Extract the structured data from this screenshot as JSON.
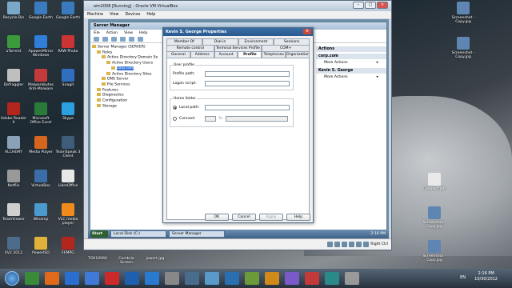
{
  "desktop_icons_left": [
    {
      "label": "Recycle Bin",
      "color": "#7aa8c8"
    },
    {
      "label": "Google Earth",
      "color": "#3a7bbf"
    },
    {
      "label": "uTorrent",
      "color": "#3c9a3c"
    },
    {
      "label": "ApowerMirror Windows",
      "color": "#2f7ed8"
    },
    {
      "label": "Defraggler",
      "color": "#bfbfbf"
    },
    {
      "label": "Malwarebytes Anti-Malware",
      "color": "#c23a3a"
    },
    {
      "label": "Adobe Reader X",
      "color": "#b3261e"
    },
    {
      "label": "Microsoft Office Excel",
      "color": "#2a7a3a"
    },
    {
      "label": "ALCHEMY",
      "color": "#8aa2b8"
    },
    {
      "label": "Media Player",
      "color": "#d4661f"
    },
    {
      "label": "Netflix",
      "color": "#999999"
    },
    {
      "label": "VirtualBox",
      "color": "#3b6ea8"
    },
    {
      "label": "TeamViewer",
      "color": "#cfcfcf"
    },
    {
      "label": "Winamp",
      "color": "#4a9ad0"
    },
    {
      "label": "SV2 2012",
      "color": "#4d6b8a"
    },
    {
      "label": "PowerISO",
      "color": "#e0b23a"
    }
  ],
  "desktop_icons_col2": [
    {
      "label": "Google Earth",
      "color": "#3a7bbf"
    },
    {
      "label": "RAW Photo",
      "color": "#cc3333"
    },
    {
      "label": "Snagit",
      "color": "#2f6fc0"
    },
    {
      "label": "Skype",
      "color": "#2aa0e0"
    },
    {
      "label": "TeamSpeak 3 Client",
      "color": "#3d5d7a"
    },
    {
      "label": "LibreOffice",
      "color": "#e8e8e8"
    },
    {
      "label": "VLC media player",
      "color": "#f08a1a"
    },
    {
      "label": "FFMPG",
      "color": "#b3261e"
    }
  ],
  "desktop_icons_right": [
    {
      "label": "Screenshot - Copy.jpg",
      "color": "#5f86b3"
    },
    {
      "label": "Screenshot - Copy.jpg",
      "color": "#5f86b3"
    },
    {
      "label": "DiskPart.pdf",
      "color": "#e9e9e9"
    },
    {
      "label": "Screenshot - Copy.jpg",
      "color": "#5f86b3"
    },
    {
      "label": "Screenshot - Copy.jpg",
      "color": "#5f86b3"
    }
  ],
  "desktop_bottom_files": [
    "TOX10960",
    "Cambria Screen",
    "jowert.jpg"
  ],
  "vbox": {
    "title": "win2008 [Running] - Oracle VM VirtualBox",
    "menu": [
      "Machine",
      "View",
      "Devices",
      "Help"
    ],
    "status_right": "Right Ctrl"
  },
  "server_manager": {
    "title": "Server Manager",
    "menu": [
      "File",
      "Action",
      "View",
      "Help"
    ],
    "tree": [
      {
        "label": "Server Manager (SERVER)",
        "indent": 0
      },
      {
        "label": "Roles",
        "indent": 1
      },
      {
        "label": "Active Directory Domain Se",
        "indent": 2
      },
      {
        "label": "Active Directory Users",
        "indent": 3
      },
      {
        "label": "corp.com",
        "indent": 4
      },
      {
        "label": "Active Directory Sites",
        "indent": 3
      },
      {
        "label": "DNS Server",
        "indent": 2
      },
      {
        "label": "File Services",
        "indent": 2
      },
      {
        "label": "Features",
        "indent": 1
      },
      {
        "label": "Diagnostics",
        "indent": 1
      },
      {
        "label": "Configuration",
        "indent": 1
      },
      {
        "label": "Storage",
        "indent": 1
      }
    ],
    "actions_header": "Actions",
    "actions_sections": [
      {
        "title": "corp.com",
        "items": [
          "More Actions"
        ]
      },
      {
        "title": "Kevin S. George",
        "items": [
          "More Actions"
        ]
      }
    ]
  },
  "dialog": {
    "title": "Kevin S. George Properties",
    "tabs_row1": [
      "Member Of",
      "Dial-in",
      "Environment",
      "Sessions"
    ],
    "tabs_row2": [
      "Remote control",
      "Terminal Services Profile",
      "COM+"
    ],
    "tabs_row3": [
      "General",
      "Address",
      "Account",
      "Profile",
      "Telephones",
      "Organization"
    ],
    "active_tab": "Profile",
    "user_profile_group": "User profile",
    "profile_path_label": "Profile path:",
    "profile_path_value": "",
    "logon_script_label": "Logon script:",
    "logon_script_value": "",
    "home_folder_group": "Home folder",
    "local_path_label": "Local path:",
    "local_path_value": "",
    "connect_label": "Connect:",
    "to_label": "To:",
    "buttons": {
      "ok": "OK",
      "cancel": "Cancel",
      "apply": "Apply",
      "help": "Help"
    }
  },
  "guest_taskbar": {
    "start": "Start",
    "items": [
      "Local Disk (C:)",
      "Server Manager"
    ],
    "clock": "2:16 PM"
  },
  "host_taskbar": {
    "lang": "EN",
    "time": "2:16 PM",
    "date": "10/30/2012",
    "pinned_colors": [
      "#3a8a3a",
      "#e06a1a",
      "#2a6fd0",
      "#3f7bd6",
      "#cc2a2a",
      "#1f5fb0",
      "#2a7bd0",
      "#888888",
      "#4a6c8c",
      "#5a9ac8",
      "#2a6fb0",
      "#6a9a3a",
      "#d08a1a",
      "#7a5ac8",
      "#c23a3a",
      "#2a8a8a",
      "#999999"
    ]
  }
}
